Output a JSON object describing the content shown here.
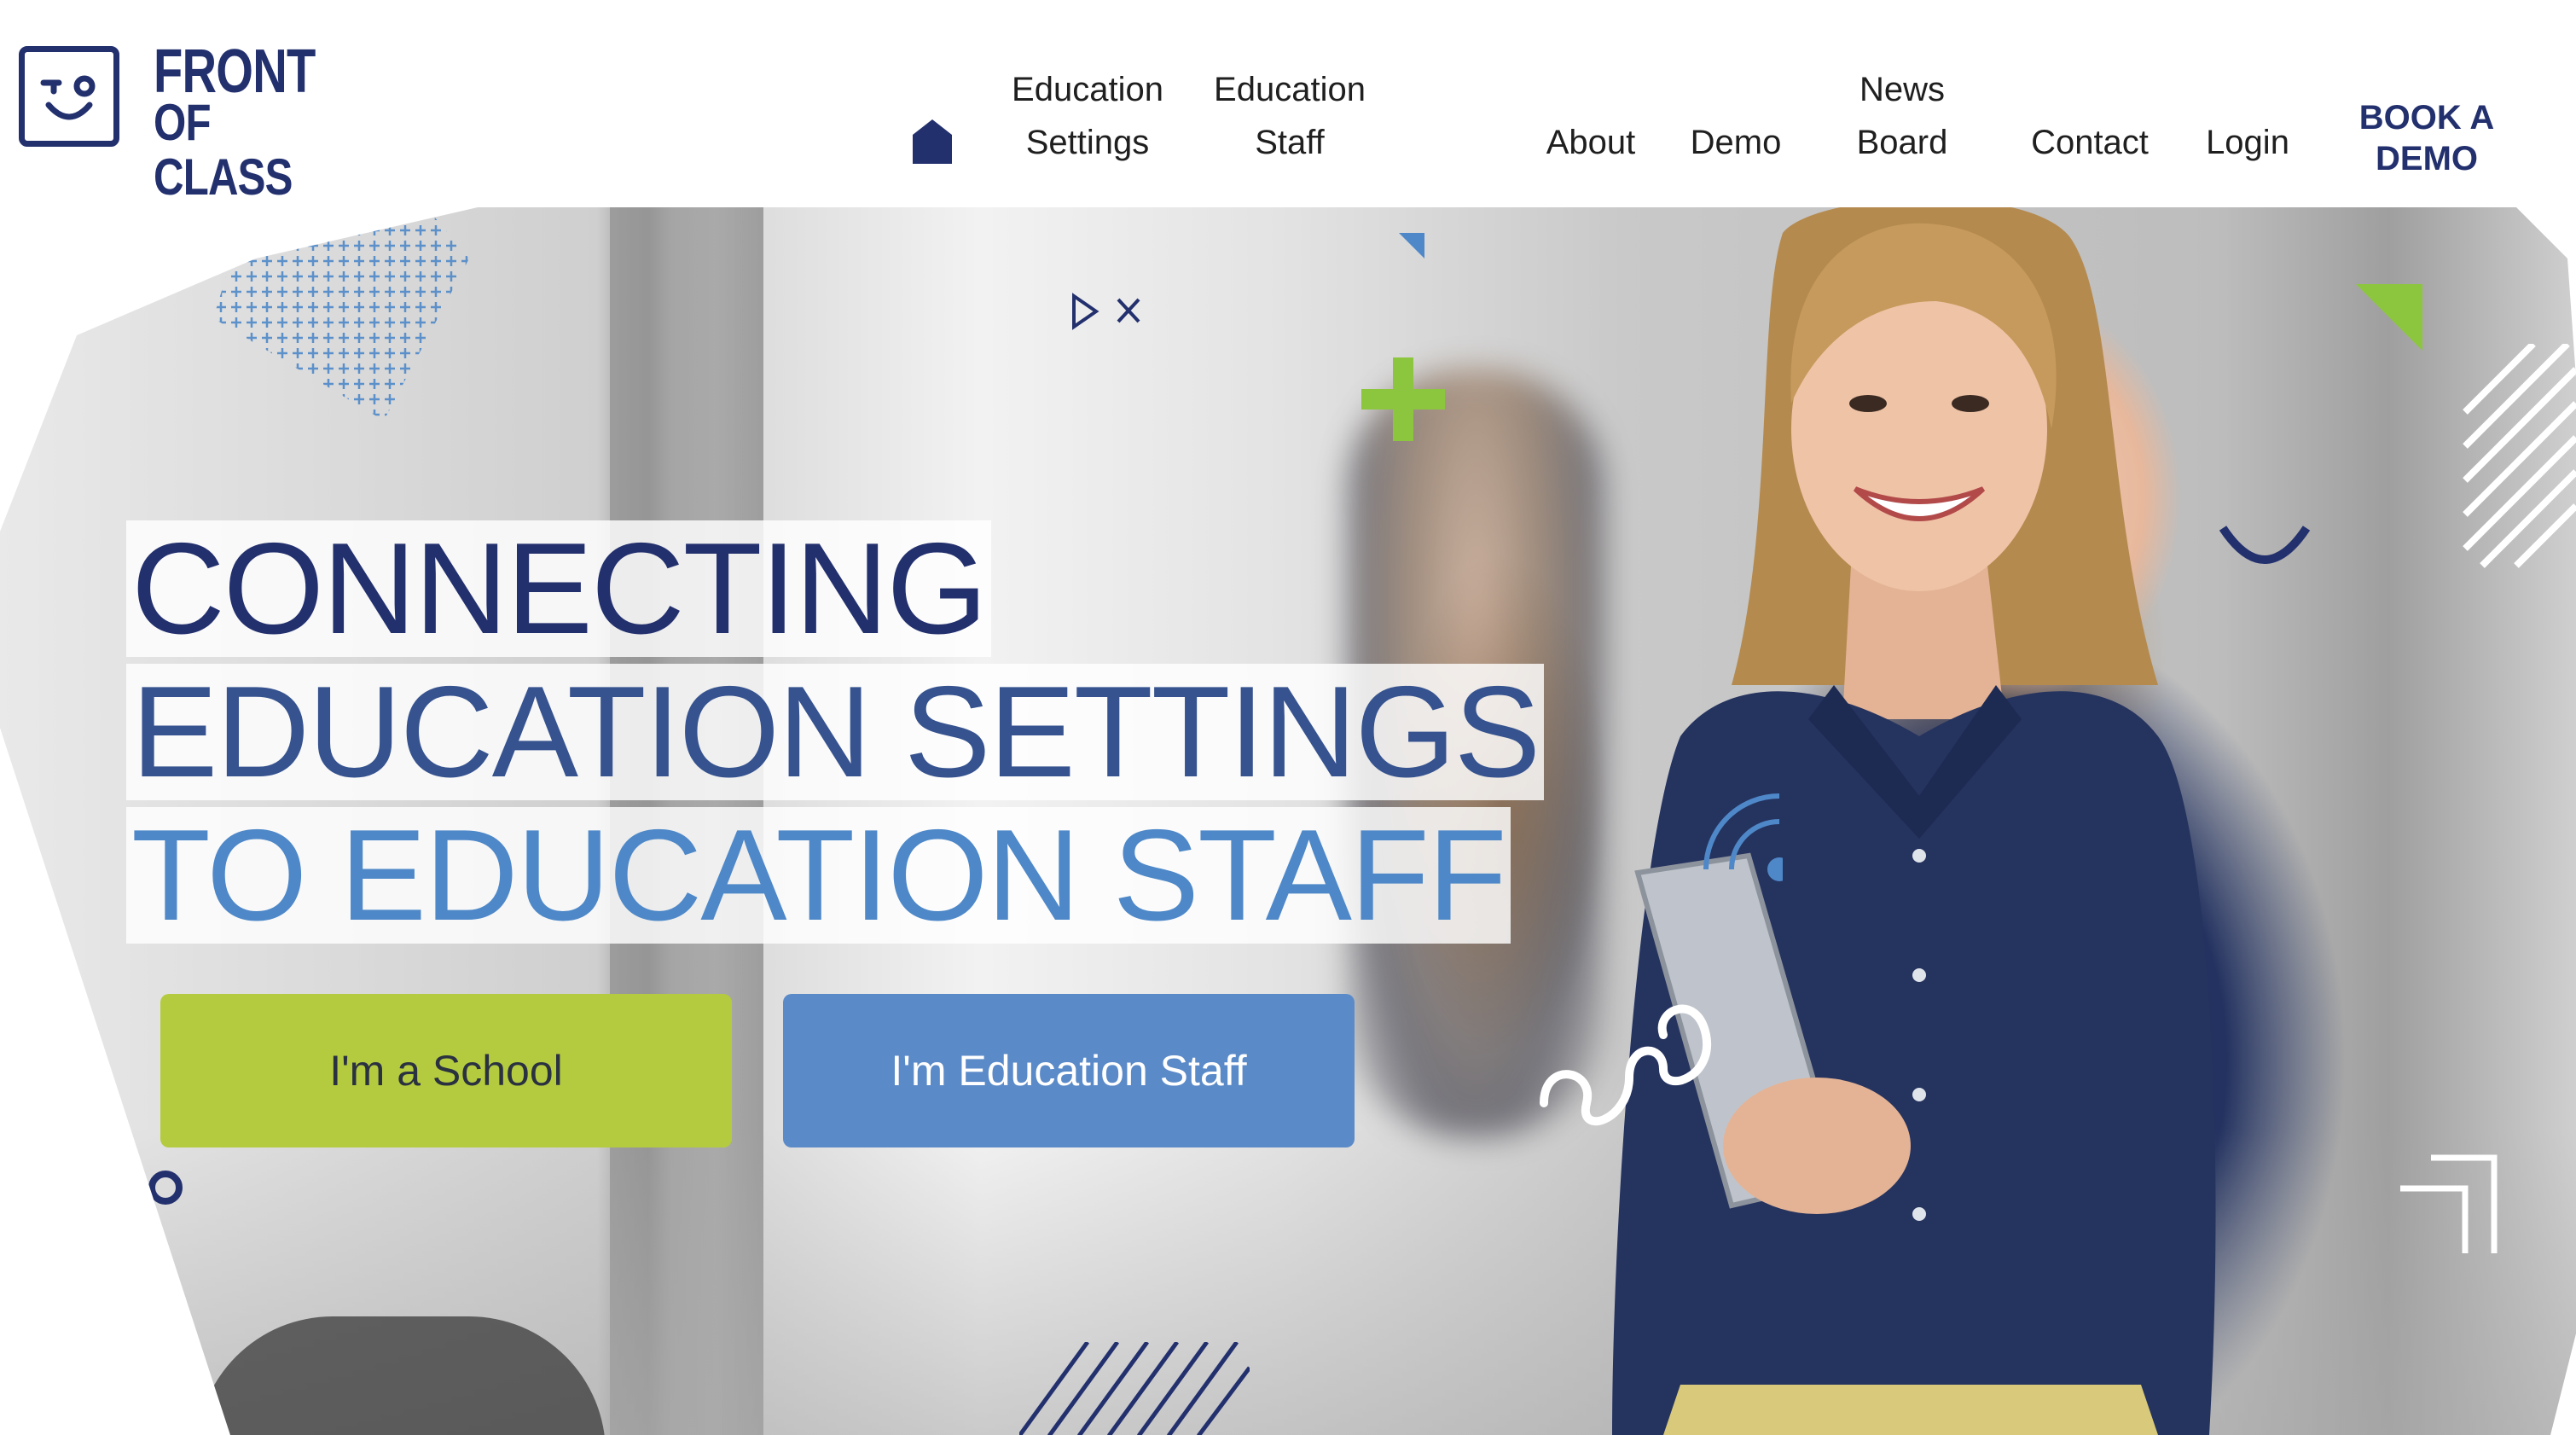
{
  "brand": {
    "name_line1": "FRONT",
    "name_line2": "OF CLASS",
    "color": "#23306e"
  },
  "nav": {
    "home_icon": "home-icon",
    "items": [
      {
        "line1": "Education",
        "line2": "Settings"
      },
      {
        "line1": "Education",
        "line2": "Staff"
      },
      {
        "line1": "",
        "line2": "About"
      },
      {
        "line1": "",
        "line2": "Demo"
      },
      {
        "line1": "News",
        "line2": "Board"
      },
      {
        "line1": "",
        "line2": "Contact"
      },
      {
        "line1": "",
        "line2": "Login"
      }
    ],
    "cta_line1": "BOOK A",
    "cta_line2": "DEMO"
  },
  "hero": {
    "headline_1": "CONNECTING",
    "headline_2": "EDUCATION SETTINGS",
    "headline_3": "TO EDUCATION STAFF",
    "button_school": "I'm a School",
    "button_staff": "I'm Education Staff"
  },
  "colors": {
    "navy": "#23306e",
    "green": "#b5cb3f",
    "blue": "#5b8ac8",
    "deco_green": "#8cc63f"
  }
}
